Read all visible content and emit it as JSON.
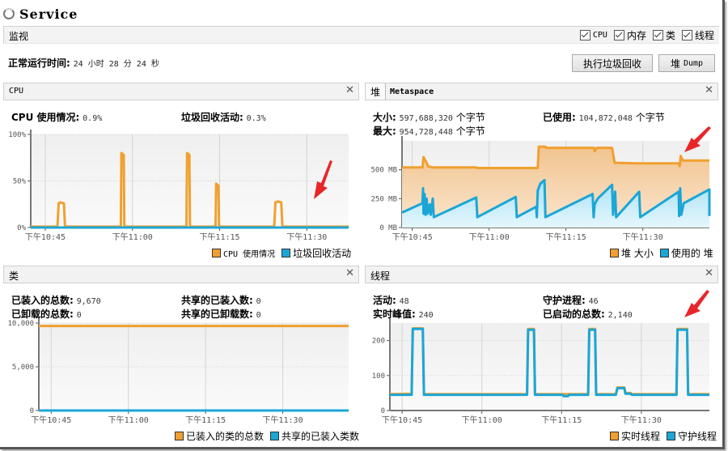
{
  "app": {
    "title": "Service"
  },
  "monitor_bar": {
    "label": "监视",
    "checkboxes": [
      {
        "label": "CPU",
        "checked": true,
        "mono": true
      },
      {
        "label": "内存",
        "checked": true
      },
      {
        "label": "类",
        "checked": true
      },
      {
        "label": "线程",
        "checked": true
      }
    ]
  },
  "uptime": {
    "label": "正常运行时间:",
    "value": "24 小时 28 分 24 秒"
  },
  "buttons": {
    "gc": "执行垃圾回收",
    "heap_dump_prefix": "堆",
    "heap_dump_suffix": "Dump"
  },
  "colors": {
    "orange": "#f0a030",
    "blue": "#1ba6d6",
    "orange_fill": "#f6d2a8",
    "blue_fill": "#cdeefa",
    "arrow": "#e8262a"
  },
  "time_ticks": [
    "下午10:45",
    "下午11:00",
    "下午11:15",
    "下午11:30"
  ],
  "cpu_panel": {
    "title": "CPU",
    "stats": [
      {
        "label": "CPU 使用情况:",
        "value": "0.9%"
      },
      {
        "label": "垃圾回收活动:",
        "value": "0.3%"
      }
    ],
    "legend": [
      {
        "label": "CPU 使用情况",
        "color": "#f0a030"
      },
      {
        "label": "垃圾回收活动",
        "color": "#1ba6d6"
      }
    ]
  },
  "heap_panel": {
    "tabs": [
      "堆",
      "Metaspace"
    ],
    "stats": [
      {
        "label": "大小:",
        "value": "597,688,320",
        "unit": "个字节"
      },
      {
        "label": "已使用:",
        "value": "104,872,048",
        "unit": "个字节"
      },
      {
        "label": "最大:",
        "value": "954,728,448",
        "unit": "个字节"
      }
    ],
    "legend": [
      {
        "label": "堆 大小",
        "color": "#f0a030"
      },
      {
        "label": "使用的 堆",
        "color": "#1ba6d6"
      }
    ]
  },
  "classes_panel": {
    "title": "类",
    "stats": [
      {
        "label": "已装入的总数:",
        "value": "9,670"
      },
      {
        "label": "共享的已装入数:",
        "value": "0"
      },
      {
        "label": "已卸载的总数:",
        "value": "0"
      },
      {
        "label": "共享的已卸载数:",
        "value": "0"
      }
    ],
    "legend": [
      {
        "label": "已装入的类的总数",
        "color": "#f0a030"
      },
      {
        "label": "共享的已装入类数",
        "color": "#1ba6d6"
      }
    ]
  },
  "threads_panel": {
    "title": "线程",
    "stats": [
      {
        "label": "活动:",
        "value": "48"
      },
      {
        "label": "守护进程:",
        "value": "46"
      },
      {
        "label": "实时峰值:",
        "value": "240"
      },
      {
        "label": "已启动的总数:",
        "value": "2,140"
      }
    ],
    "legend": [
      {
        "label": "实时线程",
        "color": "#f0a030"
      },
      {
        "label": "守护线程",
        "color": "#1ba6d6"
      }
    ]
  },
  "chart_data": [
    {
      "type": "line",
      "title": "CPU",
      "x_unit": "minutes since 下午10:45",
      "xlim": [
        -2.5,
        52.2
      ],
      "x_tick_labels": [
        "下午10:45",
        "下午11:00",
        "下午11:15",
        "下午11:30"
      ],
      "x_ticks": [
        0,
        15,
        30,
        45
      ],
      "ylim": [
        0,
        100
      ],
      "y_ticks": [
        0,
        50,
        100
      ],
      "y_tick_labels": [
        "0%",
        "50%",
        "100%"
      ],
      "grid": true,
      "legend": "bottom-right",
      "series": [
        {
          "name": "CPU 使用情况",
          "color": "#f0a030",
          "points": [
            [
              -2.5,
              1
            ],
            [
              2.1,
              1
            ],
            [
              2.3,
              26
            ],
            [
              2.6,
              27
            ],
            [
              3.2,
              26
            ],
            [
              3.4,
              1
            ],
            [
              13.0,
              1
            ],
            [
              13.1,
              80
            ],
            [
              13.5,
              78
            ],
            [
              13.6,
              1
            ],
            [
              24.3,
              1
            ],
            [
              24.4,
              80
            ],
            [
              24.8,
              78
            ],
            [
              24.9,
              1
            ],
            [
              29.3,
              1
            ],
            [
              29.4,
              47
            ],
            [
              29.8,
              45
            ],
            [
              29.9,
              1
            ],
            [
              39.4,
              1
            ],
            [
              39.6,
              27
            ],
            [
              40.0,
              28
            ],
            [
              40.6,
              27
            ],
            [
              40.8,
              1
            ],
            [
              52.2,
              1
            ]
          ]
        },
        {
          "name": "垃圾回收活动",
          "color": "#1ba6d6",
          "points": [
            [
              -2.5,
              0
            ],
            [
              52.2,
              0
            ]
          ]
        }
      ]
    },
    {
      "type": "area",
      "title": "堆",
      "x_unit": "minutes since 下午10:45",
      "xlim": [
        -2.0,
        58.0
      ],
      "x_tick_labels": [
        "下午10:45",
        "下午11:00",
        "下午11:15",
        "下午11:30"
      ],
      "x_ticks": [
        0,
        15,
        30,
        45
      ],
      "ylim": [
        0,
        750
      ],
      "y_ticks": [
        0,
        250,
        500
      ],
      "y_tick_labels": [
        "0 MB",
        "250 MB",
        "500 MB"
      ],
      "grid": true,
      "legend": "bottom-right",
      "series": [
        {
          "name": "堆 大小",
          "color": "#f0a030",
          "points": [
            [
              -2,
              520
            ],
            [
              2.0,
              520
            ],
            [
              2.2,
              610
            ],
            [
              2.8,
              560
            ],
            [
              3.1,
              530
            ],
            [
              4.0,
              520
            ],
            [
              12.5,
              520
            ],
            [
              12.7,
              515
            ],
            [
              24.5,
              515
            ],
            [
              24.7,
              700
            ],
            [
              26.0,
              700
            ],
            [
              26.2,
              690
            ],
            [
              35.5,
              690
            ],
            [
              35.6,
              660
            ],
            [
              36.0,
              690
            ],
            [
              39.0,
              690
            ],
            [
              39.5,
              560
            ],
            [
              44.0,
              555
            ],
            [
              52.0,
              555
            ],
            [
              52.2,
              530
            ],
            [
              52.4,
              620
            ],
            [
              52.8,
              580
            ],
            [
              58,
              580
            ]
          ]
        },
        {
          "name": "使用的 堆",
          "color": "#1ba6d6",
          "points": [
            [
              -2,
              130
            ],
            [
              2.0,
              210
            ],
            [
              2.1,
              340
            ],
            [
              2.2,
              120
            ],
            [
              2.4,
              290
            ],
            [
              2.6,
              110
            ],
            [
              2.8,
              250
            ],
            [
              3.0,
              120
            ],
            [
              3.4,
              200
            ],
            [
              3.6,
              110
            ],
            [
              4.0,
              250
            ],
            [
              4.2,
              90
            ],
            [
              12.5,
              260
            ],
            [
              12.7,
              90
            ],
            [
              20.2,
              265
            ],
            [
              20.4,
              90
            ],
            [
              24.2,
              180
            ],
            [
              24.3,
              90
            ],
            [
              24.5,
              320
            ],
            [
              25.0,
              380
            ],
            [
              25.8,
              410
            ],
            [
              26.0,
              90
            ],
            [
              35.2,
              290
            ],
            [
              35.4,
              90
            ],
            [
              35.6,
              200
            ],
            [
              36.2,
              250
            ],
            [
              39.0,
              370
            ],
            [
              39.2,
              110
            ],
            [
              39.6,
              310
            ],
            [
              39.8,
              90
            ],
            [
              44.3,
              310
            ],
            [
              44.5,
              90
            ],
            [
              52.0,
              310
            ],
            [
              52.1,
              100
            ],
            [
              52.3,
              340
            ],
            [
              52.5,
              110
            ],
            [
              53.0,
              210
            ],
            [
              58,
              330
            ],
            [
              58,
              100
            ]
          ]
        }
      ]
    },
    {
      "type": "line",
      "title": "类",
      "x_unit": "minutes since 下午10:45",
      "xlim": [
        -2.4,
        57.8
      ],
      "x_tick_labels": [
        "下午10:45",
        "下午11:00",
        "下午11:15",
        "下午11:30"
      ],
      "x_ticks": [
        0,
        15,
        30,
        45
      ],
      "ylim": [
        0,
        10000
      ],
      "y_ticks": [
        0,
        5000,
        10000
      ],
      "y_tick_labels": [
        "0",
        "5,000",
        "10,000"
      ],
      "grid": true,
      "legend": "bottom-right",
      "series": [
        {
          "name": "已装入的类的总数",
          "color": "#f0a030",
          "points": [
            [
              -2.4,
              9670
            ],
            [
              57.8,
              9670
            ]
          ]
        },
        {
          "name": "共享的已装入类数",
          "color": "#1ba6d6",
          "points": [
            [
              -2.4,
              0
            ],
            [
              57.8,
              0
            ]
          ]
        }
      ]
    },
    {
      "type": "line",
      "title": "线程",
      "x_unit": "minutes since 下午10:45",
      "xlim": [
        -2.3,
        57.8
      ],
      "x_tick_labels": [
        "下午10:45",
        "下午11:00",
        "下午11:15",
        "下午11:30"
      ],
      "x_ticks": [
        0,
        15,
        30,
        45
      ],
      "ylim": [
        0,
        250
      ],
      "y_ticks": [
        0,
        100,
        200
      ],
      "y_tick_labels": [
        "0",
        "100",
        "200"
      ],
      "grid": true,
      "legend": "bottom-right",
      "series": [
        {
          "name": "实时线程",
          "color": "#f0a030",
          "points": [
            [
              -2.3,
              47
            ],
            [
              1.8,
              48
            ],
            [
              2.0,
              235
            ],
            [
              3.9,
              235
            ],
            [
              4.1,
              47
            ],
            [
              23.5,
              47
            ],
            [
              23.7,
              233
            ],
            [
              24.8,
              233
            ],
            [
              25.0,
              47
            ],
            [
              35.0,
              47
            ],
            [
              35.2,
              233
            ],
            [
              36.3,
              233
            ],
            [
              36.5,
              47
            ],
            [
              40.2,
              47
            ],
            [
              40.5,
              66
            ],
            [
              41.8,
              66
            ],
            [
              42.0,
              50
            ],
            [
              43.0,
              50
            ],
            [
              43.2,
              47
            ],
            [
              51.6,
              47
            ],
            [
              51.8,
              233
            ],
            [
              53.6,
              233
            ],
            [
              53.8,
              47
            ],
            [
              57.8,
              47
            ]
          ]
        },
        {
          "name": "守护线程",
          "color": "#1ba6d6",
          "points": [
            [
              -2.3,
              45
            ],
            [
              1.8,
              45
            ],
            [
              2.0,
              233
            ],
            [
              3.9,
              233
            ],
            [
              4.1,
              45
            ],
            [
              23.5,
              45
            ],
            [
              23.7,
              231
            ],
            [
              24.8,
              231
            ],
            [
              25.0,
              45
            ],
            [
              30.2,
              45
            ],
            [
              30.4,
              41
            ],
            [
              31.2,
              41
            ],
            [
              31.4,
              45
            ],
            [
              35.0,
              45
            ],
            [
              35.2,
              231
            ],
            [
              36.3,
              231
            ],
            [
              36.5,
              45
            ],
            [
              40.2,
              45
            ],
            [
              40.5,
              64
            ],
            [
              41.8,
              64
            ],
            [
              42.0,
              48
            ],
            [
              43.0,
              48
            ],
            [
              43.2,
              45
            ],
            [
              51.6,
              45
            ],
            [
              51.8,
              231
            ],
            [
              53.6,
              231
            ],
            [
              53.8,
              45
            ],
            [
              57.8,
              45
            ]
          ]
        }
      ]
    }
  ]
}
